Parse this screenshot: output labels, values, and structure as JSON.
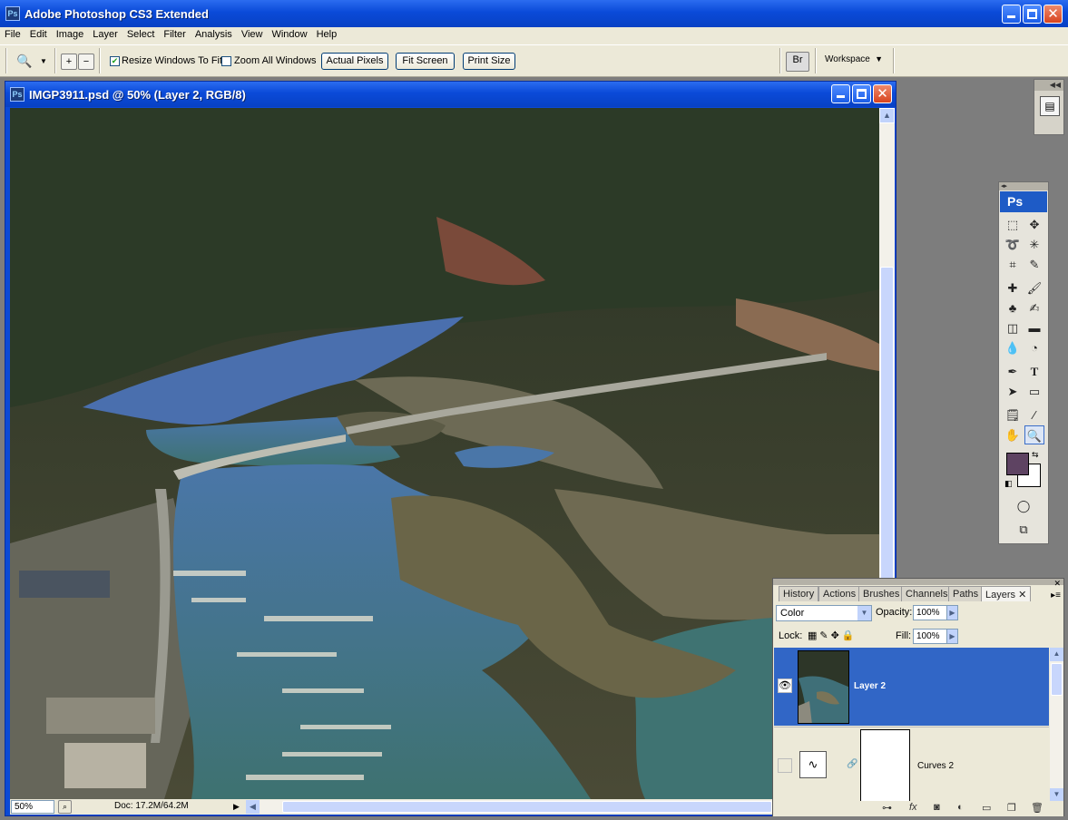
{
  "app": {
    "title": "Adobe Photoshop CS3 Extended",
    "logo_text": "Ps"
  },
  "menu": [
    "File",
    "Edit",
    "Image",
    "Layer",
    "Select",
    "Filter",
    "Analysis",
    "View",
    "Window",
    "Help"
  ],
  "options_bar": {
    "resize_windows_label": "Resize Windows To Fit",
    "resize_windows_checked": true,
    "zoom_all_label": "Zoom All Windows",
    "zoom_all_checked": false,
    "actual_pixels": "Actual Pixels",
    "fit_screen": "Fit Screen",
    "print_size": "Print Size",
    "workspace": "Workspace"
  },
  "document": {
    "title": "IMGP3911.psd @ 50% (Layer 2, RGB/8)",
    "zoom": "50%",
    "doc_info": "Doc: 17.2M/64.2M"
  },
  "tools": {
    "badge": "Ps",
    "foreground_color": "#5e4362",
    "background_color": "#ffffff"
  },
  "layers_panel": {
    "tabs": [
      "History",
      "Actions",
      "Brushes",
      "Channels",
      "Paths",
      "Layers"
    ],
    "active_tab": "Layers",
    "blend_mode": "Color",
    "opacity_label": "Opacity:",
    "opacity": "100%",
    "lock_label": "Lock:",
    "fill_label": "Fill:",
    "fill": "100%",
    "layers": [
      {
        "name": "Layer 2",
        "selected": true,
        "visible": true
      },
      {
        "name": "Curves 2",
        "selected": false,
        "visible": false
      }
    ]
  },
  "colors": {
    "titlebar": "#0a4ad8",
    "chrome": "#ece9d8",
    "selection": "#3166c6"
  }
}
